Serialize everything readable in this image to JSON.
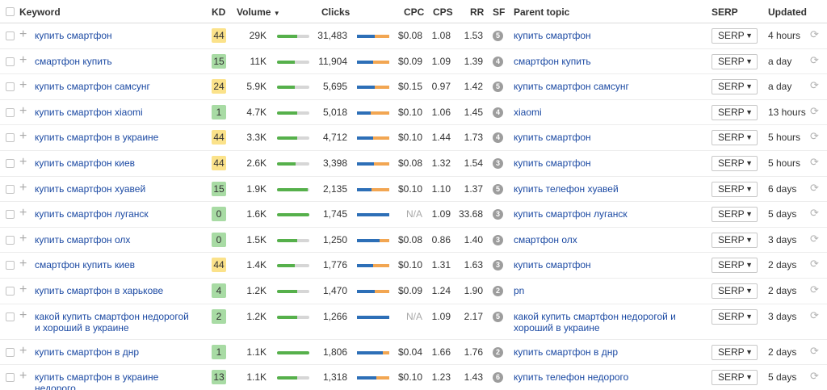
{
  "columns": {
    "keyword": "Keyword",
    "kd": "KD",
    "volume": "Volume",
    "volume_sort": "▼",
    "clicks": "Clicks",
    "cpc": "CPC",
    "cps": "CPS",
    "rr": "RR",
    "sf": "SF",
    "parent_topic": "Parent topic",
    "serp": "SERP",
    "updated": "Updated"
  },
  "serp_button_label": "SERP",
  "serp_arrow": "▼",
  "plus_icon": "+",
  "refresh_icon": "⟳",
  "colors": {
    "kd_yellow": "#fbe28a",
    "kd_green": "#a8dba4",
    "link": "#1c4aa3",
    "volume_bar": "#56b04b",
    "clicks_organic": "#2d6fb7",
    "clicks_paid": "#f2a652"
  },
  "rows": [
    {
      "keyword": "купить смартфон",
      "kd": "44",
      "kd_color": "#fbe28a",
      "volume": "29K",
      "volume_level": 0.62,
      "clicks": "31,483",
      "clicks_organic": 0.55,
      "clicks_paid": 0.45,
      "cpc": "$0.08",
      "cps": "1.08",
      "rr": "1.53",
      "sf": "5",
      "parent": "купить смартфон",
      "updated": "4 hours"
    },
    {
      "keyword": "смартфон купить",
      "kd": "15",
      "kd_color": "#a8dba4",
      "volume": "11K",
      "volume_level": 0.55,
      "clicks": "11,904",
      "clicks_organic": 0.5,
      "clicks_paid": 0.5,
      "cpc": "$0.09",
      "cps": "1.09",
      "rr": "1.39",
      "sf": "4",
      "parent": "смартфон купить",
      "updated": "a day"
    },
    {
      "keyword": "купить смартфон самсунг",
      "kd": "24",
      "kd_color": "#fbe28a",
      "volume": "5.9K",
      "volume_level": 0.55,
      "clicks": "5,695",
      "clicks_organic": 0.55,
      "clicks_paid": 0.45,
      "cpc": "$0.15",
      "cps": "0.97",
      "rr": "1.42",
      "sf": "5",
      "parent": "купить смартфон самсунг",
      "updated": "a day"
    },
    {
      "keyword": "купить смартфон xiaomi",
      "kd": "1",
      "kd_color": "#a8dba4",
      "volume": "4.7K",
      "volume_level": 0.62,
      "clicks": "5,018",
      "clicks_organic": 0.42,
      "clicks_paid": 0.58,
      "cpc": "$0.10",
      "cps": "1.06",
      "rr": "1.45",
      "sf": "4",
      "parent": "xiaomi",
      "updated": "13 hours"
    },
    {
      "keyword": "купить смартфон в украине",
      "kd": "44",
      "kd_color": "#fbe28a",
      "volume": "3.3K",
      "volume_level": 0.62,
      "clicks": "4,712",
      "clicks_organic": 0.5,
      "clicks_paid": 0.5,
      "cpc": "$0.10",
      "cps": "1.44",
      "rr": "1.73",
      "sf": "4",
      "parent": "купить смартфон",
      "updated": "5 hours"
    },
    {
      "keyword": "купить смартфон киев",
      "kd": "44",
      "kd_color": "#fbe28a",
      "volume": "2.6K",
      "volume_level": 0.58,
      "clicks": "3,398",
      "clicks_organic": 0.52,
      "clicks_paid": 0.48,
      "cpc": "$0.08",
      "cps": "1.32",
      "rr": "1.54",
      "sf": "3",
      "parent": "купить смартфон",
      "updated": "5 hours"
    },
    {
      "keyword": "купить смартфон хуавей",
      "kd": "15",
      "kd_color": "#a8dba4",
      "volume": "1.9K",
      "volume_level": 0.95,
      "clicks": "2,135",
      "clicks_organic": 0.45,
      "clicks_paid": 0.55,
      "cpc": "$0.10",
      "cps": "1.10",
      "rr": "1.37",
      "sf": "5",
      "parent": "купить телефон хуавей",
      "updated": "6 days"
    },
    {
      "keyword": "купить смартфон луганск",
      "kd": "0",
      "kd_color": "#a8dba4",
      "volume": "1.6K",
      "volume_level": 1.0,
      "clicks": "1,745",
      "clicks_organic": 1.0,
      "clicks_paid": 0.0,
      "cpc": "N/A",
      "cps": "1.09",
      "rr": "33.68",
      "sf": "3",
      "parent": "купить смартфон луганск",
      "updated": "5 days"
    },
    {
      "keyword": "купить смартфон олх",
      "kd": "0",
      "kd_color": "#a8dba4",
      "volume": "1.5K",
      "volume_level": 0.62,
      "clicks": "1,250",
      "clicks_organic": 0.7,
      "clicks_paid": 0.3,
      "cpc": "$0.08",
      "cps": "0.86",
      "rr": "1.40",
      "sf": "3",
      "parent": "смартфон олх",
      "updated": "3 days"
    },
    {
      "keyword": "смартфон купить киев",
      "kd": "44",
      "kd_color": "#fbe28a",
      "volume": "1.4K",
      "volume_level": 0.55,
      "clicks": "1,776",
      "clicks_organic": 0.5,
      "clicks_paid": 0.5,
      "cpc": "$0.10",
      "cps": "1.31",
      "rr": "1.63",
      "sf": "3",
      "parent": "купить смартфон",
      "updated": "2 days"
    },
    {
      "keyword": "купить смартфон в харькове",
      "kd": "4",
      "kd_color": "#a8dba4",
      "volume": "1.2K",
      "volume_level": 0.62,
      "clicks": "1,470",
      "clicks_organic": 0.55,
      "clicks_paid": 0.45,
      "cpc": "$0.09",
      "cps": "1.24",
      "rr": "1.90",
      "sf": "2",
      "parent": "pn",
      "updated": "2 days"
    },
    {
      "keyword": "какой купить смартфон недорогой и хороший в украине",
      "kd": "2",
      "kd_color": "#a8dba4",
      "volume": "1.2K",
      "volume_level": 0.62,
      "clicks": "1,266",
      "clicks_organic": 1.0,
      "clicks_paid": 0.0,
      "cpc": "N/A",
      "cps": "1.09",
      "rr": "2.17",
      "sf": "5",
      "parent": "какой купить смартфон недорогой и хороший в украине",
      "updated": "3 days",
      "tall": true
    },
    {
      "keyword": "купить смартфон в днр",
      "kd": "1",
      "kd_color": "#a8dba4",
      "volume": "1.1K",
      "volume_level": 1.0,
      "clicks": "1,806",
      "clicks_organic": 0.8,
      "clicks_paid": 0.2,
      "cpc": "$0.04",
      "cps": "1.66",
      "rr": "1.76",
      "sf": "2",
      "parent": "купить смартфон в днр",
      "updated": "2 days"
    },
    {
      "keyword": "купить смартфон в украине недорого",
      "kd": "13",
      "kd_color": "#a8dba4",
      "volume": "1.1K",
      "volume_level": 0.62,
      "clicks": "1,318",
      "clicks_organic": 0.6,
      "clicks_paid": 0.4,
      "cpc": "$0.10",
      "cps": "1.23",
      "rr": "1.43",
      "sf": "6",
      "parent": "купить телефон недорого",
      "updated": "5 days"
    }
  ]
}
